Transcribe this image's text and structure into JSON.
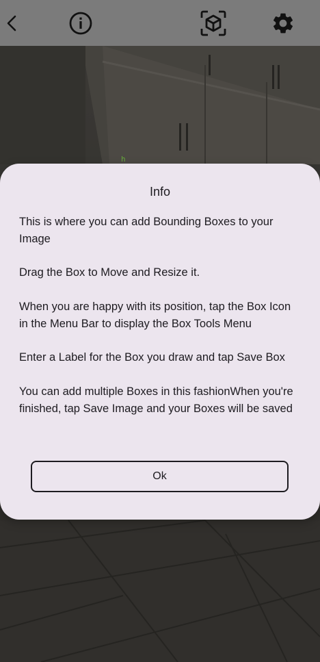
{
  "toolbar": {
    "back_icon": "chevron-left-icon",
    "info_icon": "info-circle-icon",
    "box_icon": "cube-scan-icon",
    "settings_icon": "gear-icon"
  },
  "background": {
    "overlay_label": "h"
  },
  "dialog": {
    "title": "Info",
    "paragraphs": [
      "This is where you can add Bounding Boxes to your Image",
      "Drag the Box to Move and Resize it.",
      "When you are happy with its position, tap the Box Icon in the Menu Bar to display the Box Tools Menu",
      "Enter a Label for the Box you draw and tap Save Box",
      "You can add multiple Boxes in this fashionWhen you're finished, tap Save Image and your Boxes will be saved"
    ],
    "ok_label": "Ok"
  },
  "colors": {
    "toolbar_bg": "#7b7b7b",
    "dialog_bg": "#ece5ee",
    "text": "#1d1b20",
    "overlay_label": "#7fd14a"
  }
}
